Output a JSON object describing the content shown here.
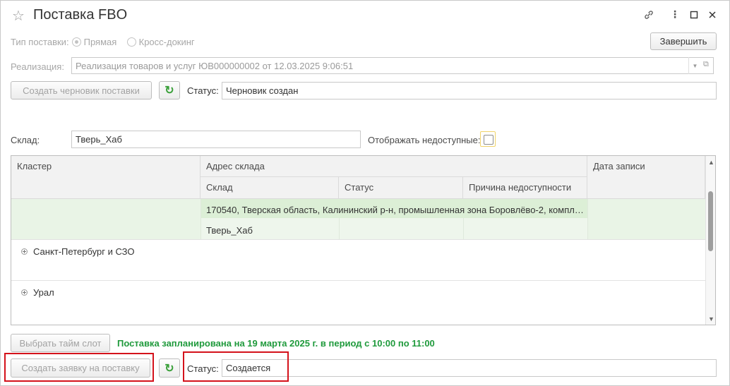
{
  "window": {
    "title": "Поставка FBO"
  },
  "supply_type": {
    "label": "Тип поставки:",
    "options": [
      {
        "label": "Прямая",
        "selected": true
      },
      {
        "label": "Кросс-докинг",
        "selected": false
      }
    ]
  },
  "finish_button": "Завершить",
  "realization": {
    "label": "Реализация:",
    "value": "Реализация товаров и услуг ЮВ000000002 от 12.03.2025 9:06:51"
  },
  "draft": {
    "create_button": "Создать черновик поставки",
    "status_label": "Статус:",
    "status_value": "Черновик создан"
  },
  "warehouse": {
    "label": "Склад:",
    "value": "Тверь_Хаб",
    "show_unavailable_label": "Отображать недоступные:"
  },
  "table": {
    "headers": {
      "cluster": "Кластер",
      "address": "Адрес склада",
      "warehouse": "Склад",
      "status": "Статус",
      "reason": "Причина недоступности",
      "record_date": "Дата записи"
    },
    "selected_row": {
      "address": "170540, Тверская область, Калининский р-н, промышленная зона Боровлёво-2, компл…",
      "warehouse": "Тверь_Хаб"
    },
    "groups": [
      {
        "label": "Санкт-Петербург и СЗО"
      },
      {
        "label": "Урал"
      }
    ]
  },
  "timeslot": {
    "button": "Выбрать тайм слот",
    "message": "Поставка запланирована на 19 марта 2025 г. в период с 10:00 по 11:00"
  },
  "request": {
    "create_button": "Создать заявку на поставку",
    "status_label": "Статус:",
    "status_value": "Создается"
  },
  "colors": {
    "accent_green": "#1f9a3c",
    "highlight_red": "#d4121b",
    "selected_row_bg": "#e9f4e6"
  }
}
